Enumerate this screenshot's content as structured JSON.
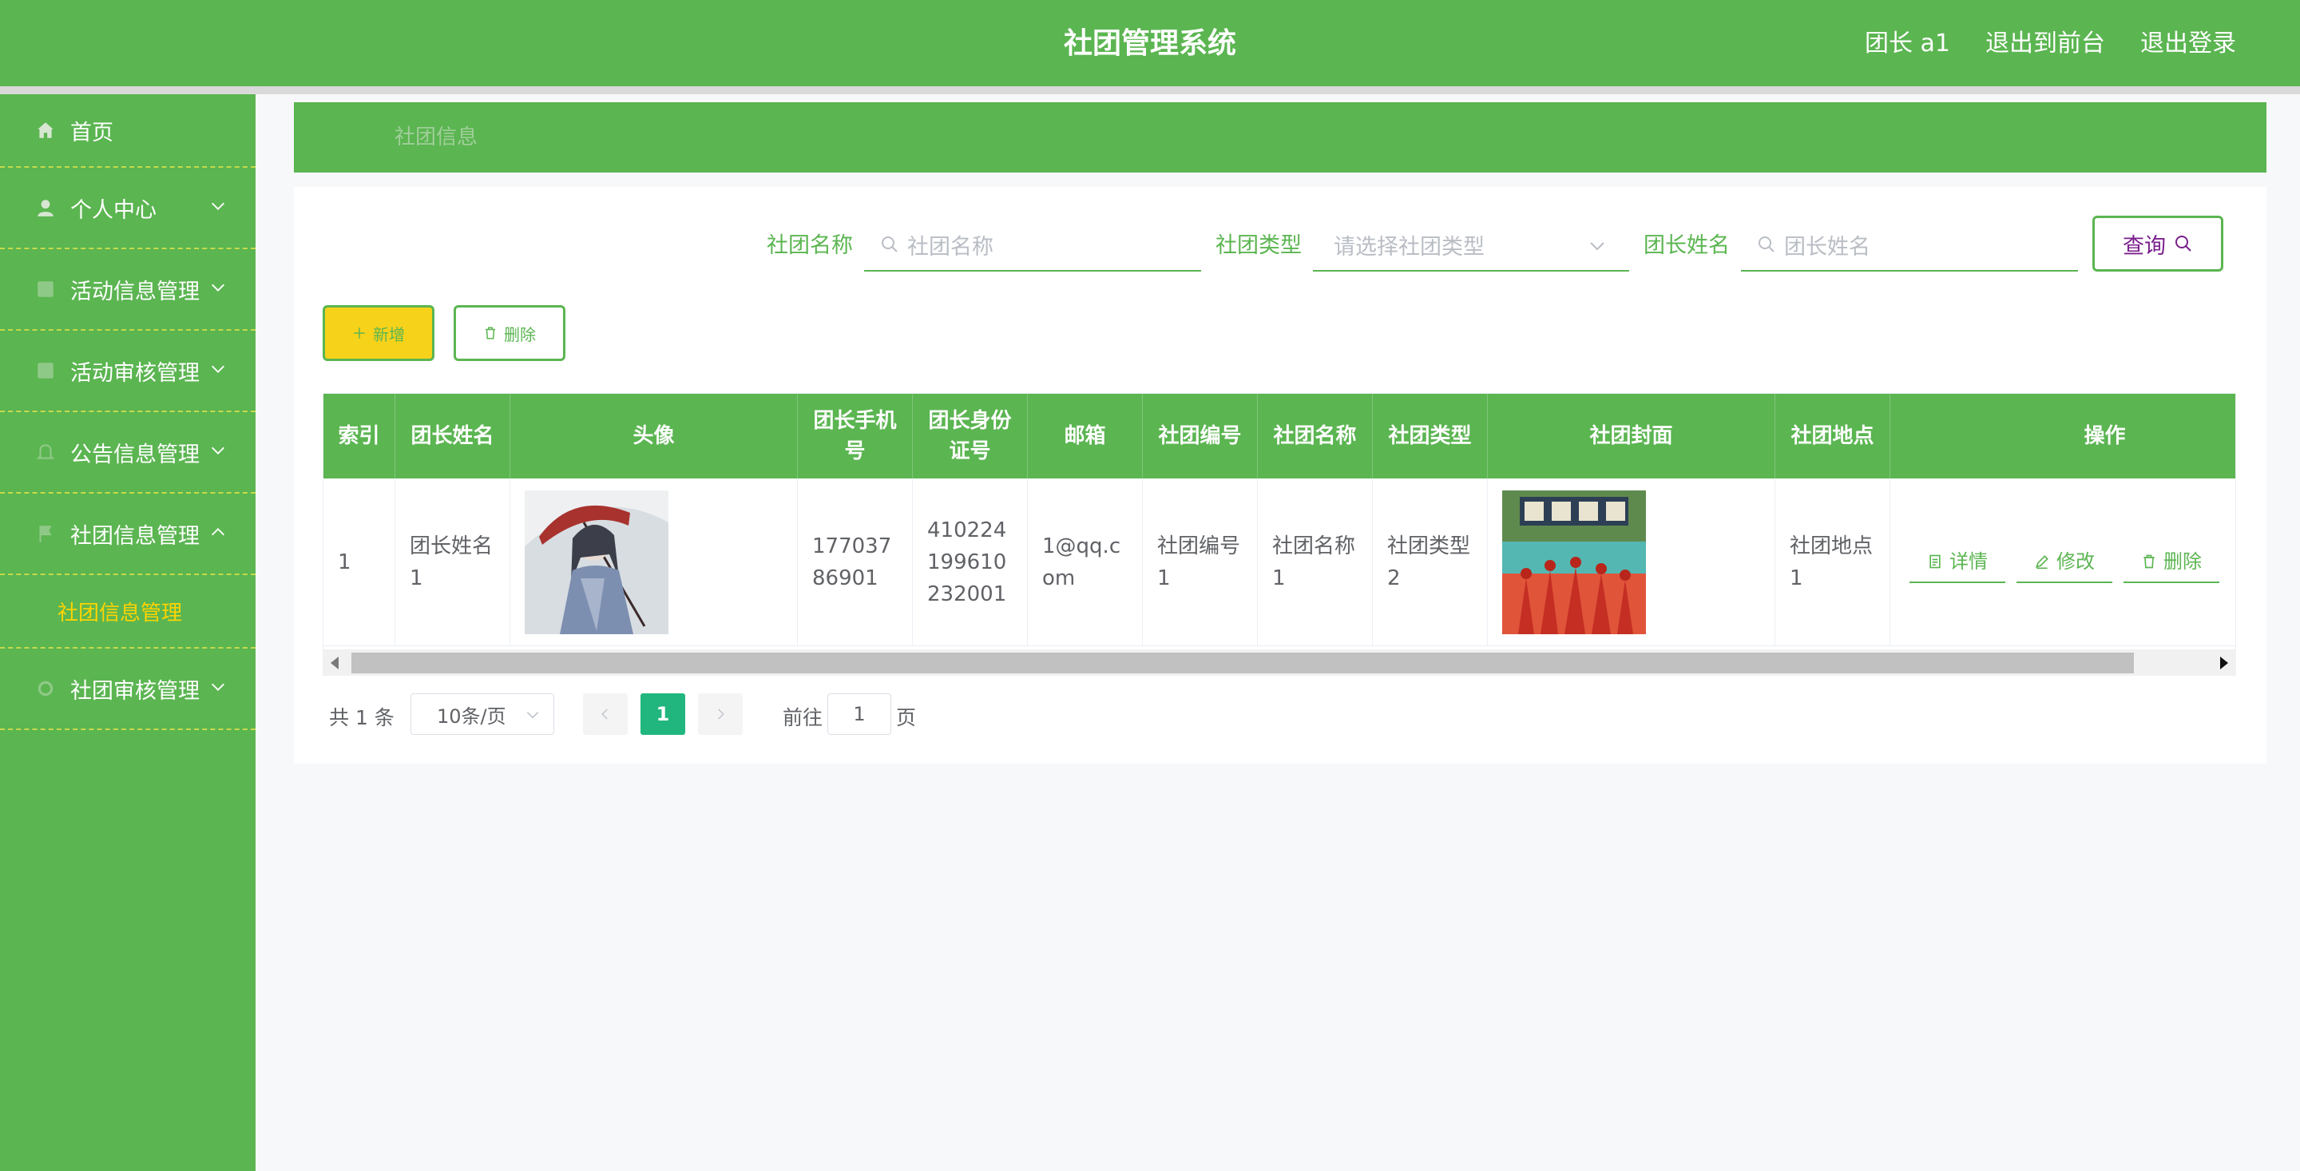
{
  "header": {
    "title": "社团管理系统",
    "user": "团长 a1",
    "to_front": "退出到前台",
    "logout": "退出登录"
  },
  "sidebar": {
    "items": [
      {
        "label": "首页",
        "icon": "home-icon"
      },
      {
        "label": "个人中心",
        "icon": "user-icon"
      },
      {
        "label": "活动信息管理",
        "icon": "list-icon"
      },
      {
        "label": "活动审核管理",
        "icon": "list-icon"
      },
      {
        "label": "公告信息管理",
        "icon": "bell-icon"
      },
      {
        "label": "社团信息管理",
        "icon": "flag-icon"
      },
      {
        "label": "社团审核管理",
        "icon": "settings-icon"
      }
    ],
    "sub_item": "社团信息管理"
  },
  "breadcrumb": {
    "current": "社团信息"
  },
  "search": {
    "name_label": "社团名称",
    "name_placeholder": "社团名称",
    "type_label": "社团类型",
    "type_placeholder": "请选择社团类型",
    "leader_label": "团长姓名",
    "leader_placeholder": "团长姓名",
    "query_label": "查询"
  },
  "actions": {
    "add_label": "新增",
    "delete_label": "删除"
  },
  "table": {
    "columns": [
      "索引",
      "团长姓名",
      "头像",
      "团长手机号",
      "团长身份证号",
      "邮箱",
      "社团编号",
      "社团名称",
      "社团类型",
      "社团封面",
      "社团地点",
      "操作"
    ],
    "rows": [
      {
        "index": "1",
        "leader_name": "团长姓名1",
        "phone": "17703786901",
        "id_card": "410224199610232001",
        "email": "1@qq.com",
        "club_no": "社团编号1",
        "club_name": "社团名称1",
        "club_type": "社团类型2",
        "location": "社团地点1"
      }
    ],
    "op_detail": "详情",
    "op_edit": "修改",
    "op_delete": "删除"
  },
  "pagination": {
    "total_text": "共 1 条",
    "page_size": "10条/页",
    "current_page": "1",
    "goto_label": "前往",
    "goto_value": "1",
    "goto_suffix": "页"
  },
  "colors": {
    "primary": "#5bb551",
    "accent_yellow": "#f7d21a",
    "active_page": "#20b67d",
    "query_text": "#7a1f8c"
  }
}
